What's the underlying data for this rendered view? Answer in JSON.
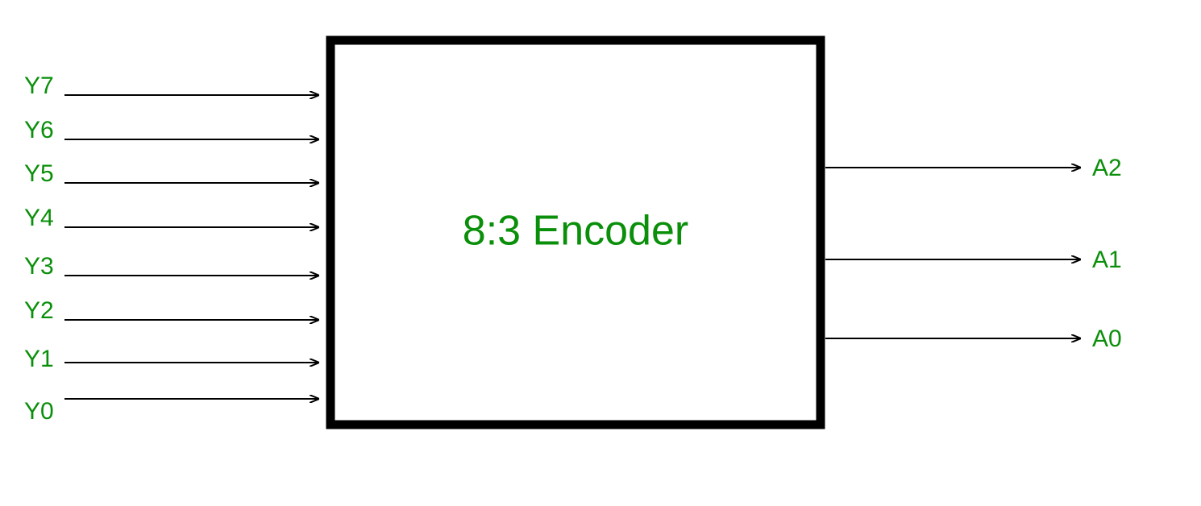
{
  "block": {
    "title": "8:3 Encoder"
  },
  "inputs": [
    {
      "label": "Y7"
    },
    {
      "label": "Y6"
    },
    {
      "label": "Y5"
    },
    {
      "label": "Y4"
    },
    {
      "label": "Y3"
    },
    {
      "label": "Y2"
    },
    {
      "label": "Y1"
    },
    {
      "label": "Y0"
    }
  ],
  "outputs": [
    {
      "label": "A2"
    },
    {
      "label": "A1"
    },
    {
      "label": "A0"
    }
  ]
}
